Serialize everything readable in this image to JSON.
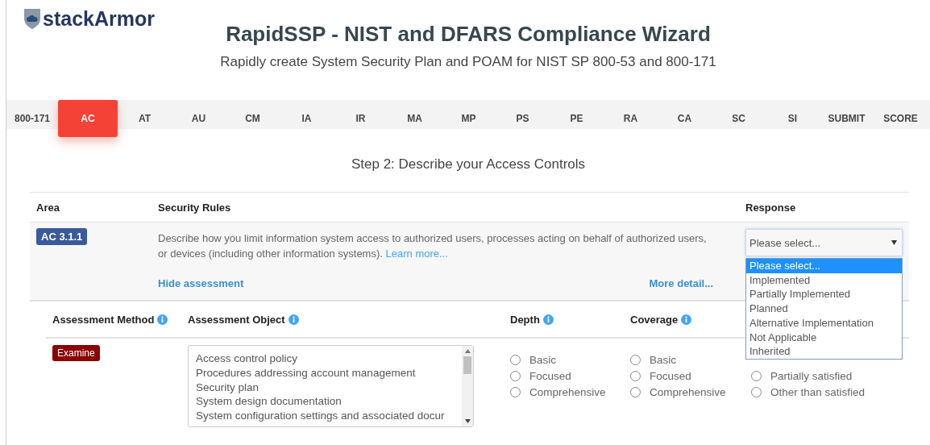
{
  "logo": {
    "text": "stackArmor"
  },
  "title": "RapidSSP - NIST and DFARS Compliance Wizard",
  "subtitle": "Rapidly create System Security Plan and POAM for NIST SP 800-53 and 800-171",
  "tabs": [
    {
      "label": "800-171",
      "selected": false
    },
    {
      "label": "AC",
      "selected": true
    },
    {
      "label": "AT",
      "selected": false
    },
    {
      "label": "AU",
      "selected": false
    },
    {
      "label": "CM",
      "selected": false
    },
    {
      "label": "IA",
      "selected": false
    },
    {
      "label": "IR",
      "selected": false
    },
    {
      "label": "MA",
      "selected": false
    },
    {
      "label": "MP",
      "selected": false
    },
    {
      "label": "PS",
      "selected": false
    },
    {
      "label": "PE",
      "selected": false
    },
    {
      "label": "RA",
      "selected": false
    },
    {
      "label": "CA",
      "selected": false
    },
    {
      "label": "SC",
      "selected": false
    },
    {
      "label": "SI",
      "selected": false
    },
    {
      "label": "SUBMIT",
      "selected": false
    },
    {
      "label": "SCORE",
      "selected": false
    }
  ],
  "step_heading": "Step 2: Describe your Access Controls",
  "table": {
    "columns": [
      "Area",
      "Security Rules",
      "Response"
    ],
    "rows": [
      {
        "area": "AC 3.1.1",
        "description": "Describe how you limit information system access to authorized users, processes acting on behalf of authorized users, or devices (including other information systems).",
        "link": "Learn more...",
        "hide_link": "Hide assessment",
        "more_link": "More detail...",
        "response": {
          "value": "Please select...",
          "options": [
            {
              "label": "Please select...",
              "selected": true
            },
            {
              "label": "Implemented",
              "selected": false
            },
            {
              "label": "Partially Implemented",
              "selected": false
            },
            {
              "label": "Planned",
              "selected": false
            },
            {
              "label": "Alternative Implementation",
              "selected": false
            },
            {
              "label": "Not Applicable",
              "selected": false
            },
            {
              "label": "Inherited",
              "selected": false
            }
          ]
        }
      }
    ]
  },
  "assessment": {
    "columns": [
      "Assessment Method",
      "Assessment Object",
      "Depth",
      "Coverage"
    ],
    "method": "Examine",
    "objects": [
      "Access control policy",
      "Procedures addressing account management",
      "Security plan",
      "System design documentation",
      "System configuration settings and associated docur"
    ],
    "option_groups": [
      [
        {
          "label": "Basic",
          "selected": false
        },
        {
          "label": "Focused",
          "selected": false
        },
        {
          "label": "Comprehensive",
          "selected": false
        }
      ],
      [
        {
          "label": "Basic",
          "selected": false
        },
        {
          "label": "Focused",
          "selected": false
        },
        {
          "label": "Comprehensive",
          "selected": false
        }
      ],
      [
        {
          "label": "Partially satisfied",
          "selected": false
        },
        {
          "label": "Other than satisfied",
          "selected": false
        }
      ]
    ]
  }
}
